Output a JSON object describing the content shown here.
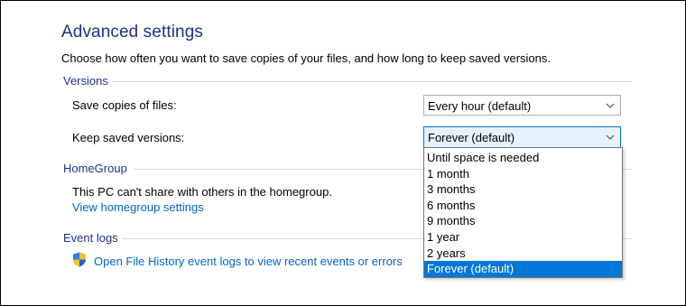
{
  "page": {
    "title": "Advanced settings",
    "description": "Choose how often you want to save copies of your files, and how long to keep saved versions."
  },
  "versions": {
    "header": "Versions",
    "save_copies": {
      "label": "Save copies of files:",
      "value": "Every hour (default)"
    },
    "keep_versions": {
      "label": "Keep saved versions:",
      "value": "Forever (default)"
    }
  },
  "dropdown": {
    "options": [
      "Until space is needed",
      "1 month",
      "3 months",
      "6 months",
      "9 months",
      "1 year",
      "2 years",
      "Forever (default)"
    ],
    "selected_index": 7
  },
  "homegroup": {
    "header": "HomeGroup",
    "text": "This PC can't share with others in the homegroup.",
    "link": "View homegroup settings"
  },
  "event_logs": {
    "header": "Event logs",
    "link": "Open File History event logs to view recent events or errors"
  },
  "colors": {
    "header_blue": "#1e3287",
    "link_blue": "#0066cc",
    "selection_blue": "#0078d7",
    "open_select_bg": "#e5f1fb"
  },
  "icons": {
    "chevron": "chevron-down-icon",
    "shield": "uac-shield-icon"
  }
}
